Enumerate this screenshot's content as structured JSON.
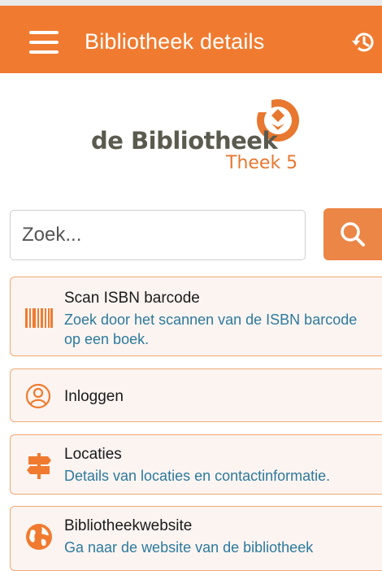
{
  "header": {
    "title": "Bibliotheek details",
    "menu_icon": "hamburger-menu-icon",
    "history_icon": "history-icon",
    "background_color": "#f07b30"
  },
  "logo": {
    "text": "de Bibliotheek",
    "subtitle": "Theek 5",
    "accent_color": "#e8772f"
  },
  "search": {
    "placeholder": "Zoek...",
    "button_icon": "search-icon"
  },
  "cards": [
    {
      "title": "Scan ISBN barcode",
      "description": "Zoek door het scannen van de ISBN barcode op een boek.",
      "icon": "barcode-icon"
    },
    {
      "title": "Inloggen",
      "description": "",
      "icon": "user-icon"
    },
    {
      "title": "Locaties",
      "description": "Details van locaties en contactinformatie.",
      "icon": "signpost-icon"
    },
    {
      "title": "Bibliotheekwebsite",
      "description": "Ga naar de website van de bibliotheek",
      "icon": "globe-icon"
    }
  ],
  "colors": {
    "accent": "#f07b30",
    "card_background": "#fbf4f1",
    "description_text": "#2d7a9d"
  }
}
